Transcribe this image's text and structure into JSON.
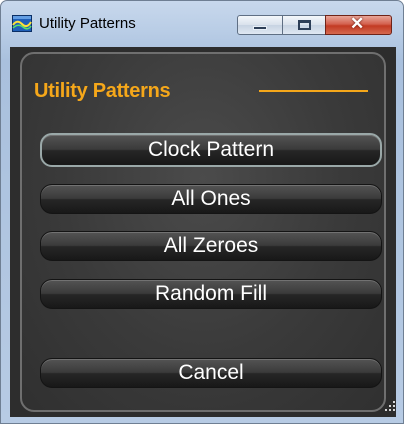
{
  "window": {
    "title": "Utility Patterns",
    "icon": "app-icon",
    "controls": {
      "minimize_icon": "minimize-icon",
      "maximize_icon": "maximize-icon",
      "close_icon": "close-icon",
      "close_glyph": "✕"
    }
  },
  "panel": {
    "title": "Utility Patterns",
    "title_color": "#f5a71a"
  },
  "buttons": {
    "clock_pattern": "Clock Pattern",
    "all_ones": "All Ones",
    "all_zeroes": "All Zeroes",
    "random_fill": "Random Fill",
    "cancel": "Cancel"
  }
}
